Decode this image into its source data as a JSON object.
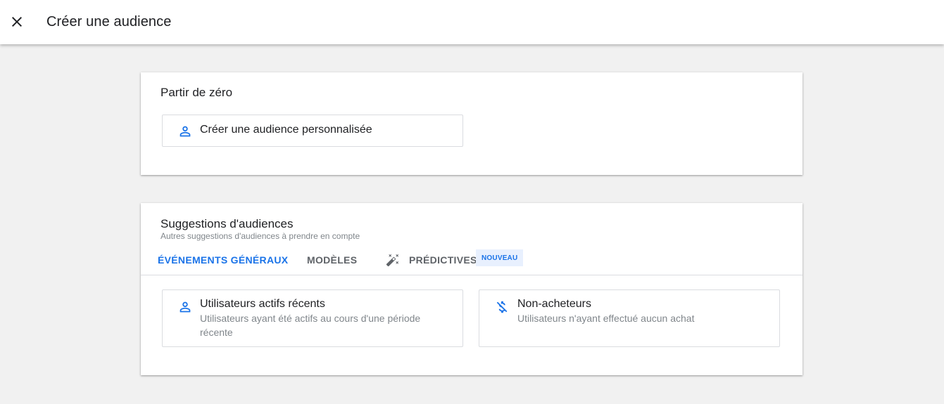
{
  "header": {
    "title": "Créer une audience",
    "close_icon": "close-icon"
  },
  "from_scratch": {
    "title": "Partir de zéro",
    "custom_option": {
      "title": "Créer une audience personnalisée",
      "icon": "person-icon"
    }
  },
  "suggestions": {
    "title": "Suggestions d'audiences",
    "subtitle": "Autres suggestions d'audiences à prendre en compte",
    "tabs": [
      {
        "label": "ÉVÉNEMENTS GÉNÉRAUX",
        "active": true
      },
      {
        "label": "MODÈLES",
        "active": false
      },
      {
        "label": "PRÉDICTIVES",
        "active": false,
        "icon": "magic-wand-icon"
      }
    ],
    "badge": "NOUVEAU",
    "options": [
      {
        "title": "Utilisateurs actifs récents",
        "description": "Utilisateurs ayant été actifs au cours d'une période récente",
        "icon": "person-icon"
      },
      {
        "title": "Non-acheteurs",
        "description": "Utilisateurs n'ayant effectué aucun achat",
        "icon": "money-off-icon"
      }
    ]
  },
  "colors": {
    "accent": "#1a73e8",
    "background": "#f1f1f1",
    "badge_bg": "#e8f0fe",
    "muted_text": "#80868b"
  }
}
